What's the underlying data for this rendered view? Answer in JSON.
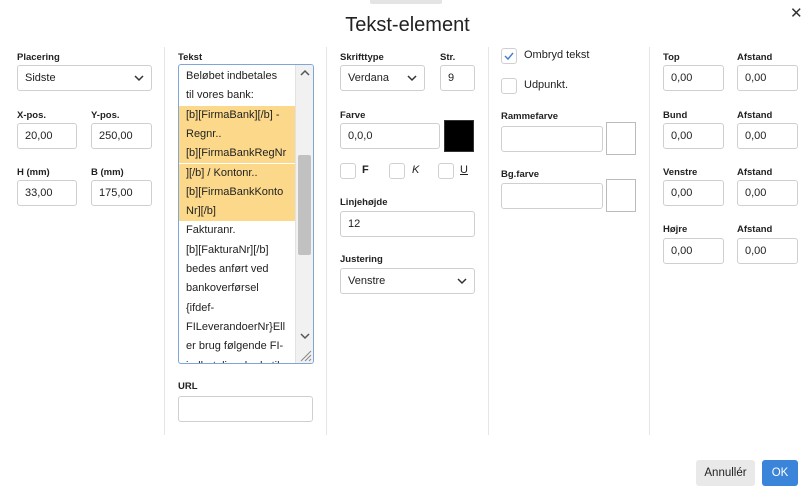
{
  "dialog": {
    "title": "Tekst-element",
    "close_icon": "✕"
  },
  "placement": {
    "label": "Placering",
    "value": "Sidste",
    "xpos_label": "X-pos.",
    "xpos_value": "20,00",
    "ypos_label": "Y-pos.",
    "ypos_value": "250,00",
    "height_label": "H (mm)",
    "height_value": "33,00",
    "width_label": "B (mm)",
    "width_value": "175,00"
  },
  "text": {
    "label": "Tekst",
    "lines": [
      {
        "text": "Beløbet indbetales",
        "highlight": false
      },
      {
        "text": "til vores bank:",
        "highlight": false
      },
      {
        "text": "[b][FirmaBank][/b] -",
        "highlight": true
      },
      {
        "text": "Regnr..",
        "highlight": true
      },
      {
        "text": "[b][FirmaBankRegNr",
        "highlight": true
      },
      {
        "text": "][/b] / Kontonr..",
        "highlight": true
      },
      {
        "text": "[b][FirmaBankKonto",
        "highlight": true
      },
      {
        "text": "Nr][/b]",
        "highlight": true
      },
      {
        "text": "Fakturanr.",
        "highlight": false
      },
      {
        "text": "[b][FakturaNr][/b]",
        "highlight": false
      },
      {
        "text": "bedes anført ved",
        "highlight": false
      },
      {
        "text": "bankoverførsel",
        "highlight": false
      },
      {
        "text": "{ifdef-",
        "highlight": false
      },
      {
        "text": "FILeverandoerNr}Ell",
        "highlight": false
      },
      {
        "text": "er brug følgende FI-",
        "highlight": false
      },
      {
        "text": "indbetalingskode til",
        "highlight": false
      }
    ],
    "url_label": "URL",
    "url_value": ""
  },
  "font": {
    "family_label": "Skrifttype",
    "family_value": "Verdana",
    "size_label": "Str.",
    "size_value": "9",
    "color_label": "Farve",
    "color_value": "0,0,0",
    "color_swatch": "#000000",
    "bold_label": "F",
    "italic_label": "K",
    "underline_label": "U",
    "line_height_label": "Linjehøjde",
    "line_height_value": "12",
    "align_label": "Justering",
    "align_value": "Venstre"
  },
  "options": {
    "wrap_label": "Ombryd tekst",
    "wrap_checked": true,
    "point_label": "Udpunkt.",
    "point_checked": false,
    "frame_color_label": "Rammefarve",
    "frame_color_value": "",
    "bg_color_label": "Bg.farve",
    "bg_color_value": ""
  },
  "margins": {
    "top_label": "Top",
    "top_value": "0,00",
    "top_dist_label": "Afstand",
    "top_dist_value": "0,00",
    "bottom_label": "Bund",
    "bottom_value": "0,00",
    "bottom_dist_label": "Afstand",
    "bottom_dist_value": "0,00",
    "left_label": "Venstre",
    "left_value": "0,00",
    "left_dist_label": "Afstand",
    "left_dist_value": "0,00",
    "right_label": "Højre",
    "right_value": "0,00",
    "right_dist_label": "Afstand",
    "right_dist_value": "0,00"
  },
  "footer": {
    "cancel_label": "Annullér",
    "ok_label": "OK"
  },
  "colors": {
    "accent": "#3a84d9",
    "highlight": "#fcd98a",
    "spell_error": "#d64040"
  }
}
